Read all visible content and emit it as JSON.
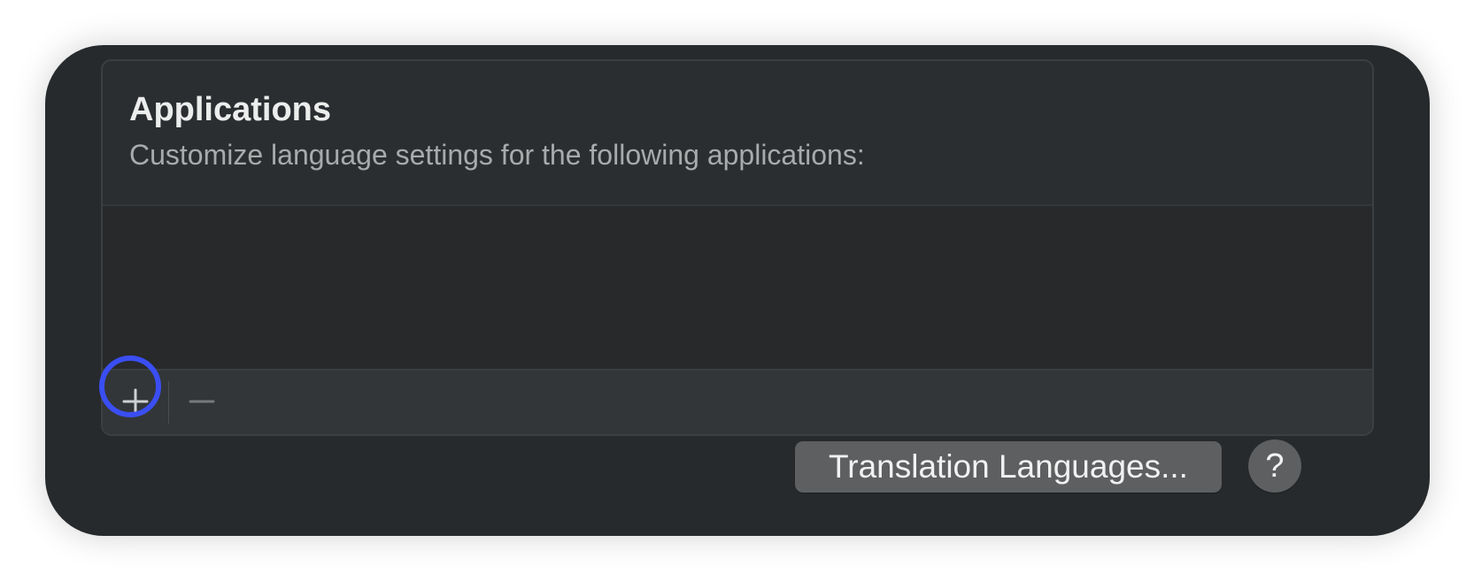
{
  "applications_group": {
    "title": "Applications",
    "subtitle": "Customize language settings for the following applications:",
    "items": [],
    "toolbar": {
      "add_icon": "plus-icon",
      "remove_icon": "minus-icon"
    }
  },
  "footer": {
    "translation_button_label": "Translation Languages...",
    "help_button_label": "?"
  },
  "colors": {
    "window_background": "#272a2c",
    "highlight_ring": "#3a4ef2",
    "button_background": "#5d5f61"
  }
}
